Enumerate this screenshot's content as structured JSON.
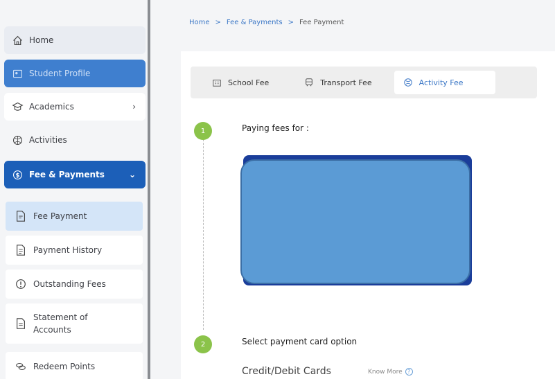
{
  "sidebar": {
    "home": "Home",
    "student_profile": "Student Profile",
    "academics": "Academics",
    "activities": "Activities",
    "fee_payments": "Fee & Payments",
    "sub_items": {
      "fee_payment": "Fee Payment",
      "payment_history": "Payment History",
      "outstanding_fees": "Outstanding Fees",
      "statement_line1": "Statement of",
      "statement_line2": "Accounts",
      "redeem_points": "Redeem Points"
    }
  },
  "breadcrumb": {
    "home": "Home",
    "sep1": ">",
    "section": "Fee & Payments",
    "sep2": ">",
    "current": "Fee Payment"
  },
  "tabs": {
    "school_fee": "School Fee",
    "transport_fee": "Transport Fee",
    "activity_fee": "Activity Fee",
    "active": "activity_fee"
  },
  "steps": {
    "step1_number": "1",
    "step1_title": "Paying fees for :",
    "step2_number": "2",
    "step2_title": "Select payment card option"
  },
  "payment": {
    "option_label": "Credit/Debit Cards",
    "know_more": "Know More",
    "help_glyph": "?"
  },
  "colors": {
    "accent": "#1c5fb8",
    "profile_bg": "#3f7fcf",
    "active_sub": "#d4e5f8",
    "step_green": "#8bc34a",
    "card_blue": "#5b9bd5",
    "card_dark": "#1a3d9a"
  }
}
